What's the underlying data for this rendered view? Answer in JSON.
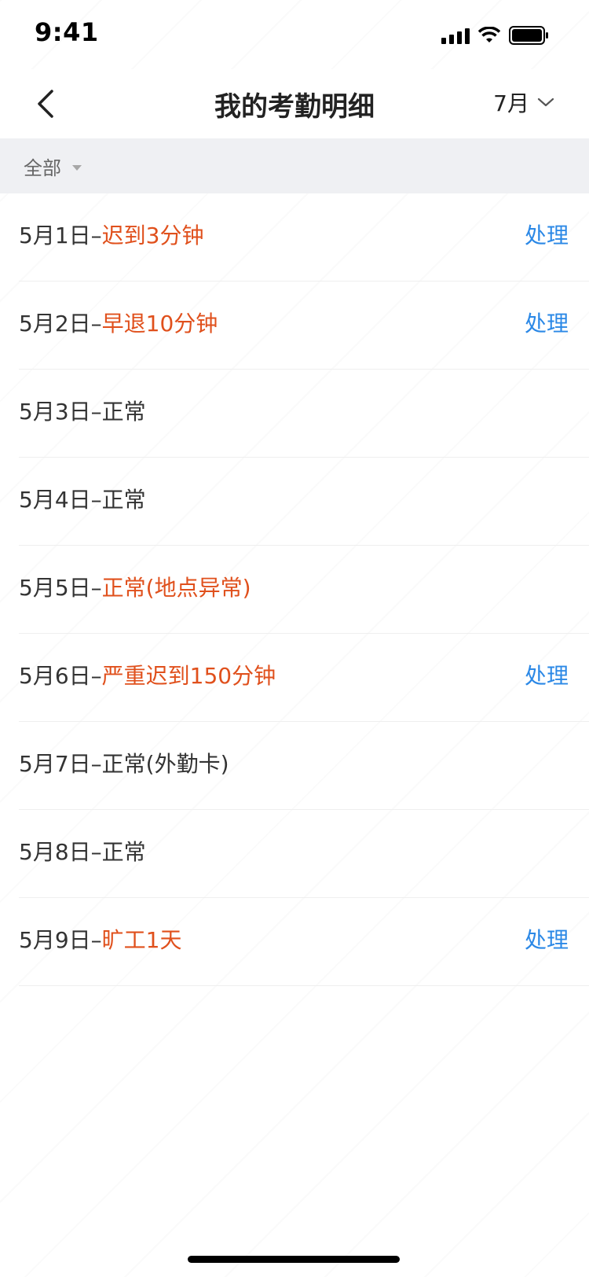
{
  "status_bar": {
    "time": "9:41"
  },
  "nav": {
    "title": "我的考勤明细",
    "month": "7月"
  },
  "filter": {
    "label": "全部"
  },
  "rows": [
    {
      "date": "5月1日–",
      "status": "迟到3分钟",
      "abnormal": true,
      "action": "处理"
    },
    {
      "date": "5月2日–",
      "status": "早退10分钟",
      "abnormal": true,
      "action": "处理"
    },
    {
      "date": "5月3日–",
      "status": "正常",
      "abnormal": false,
      "action": ""
    },
    {
      "date": "5月4日–",
      "status": "正常",
      "abnormal": false,
      "action": ""
    },
    {
      "date": "5月5日–",
      "status": "正常(地点异常)",
      "abnormal": true,
      "action": ""
    },
    {
      "date": "5月6日–",
      "status": "严重迟到150分钟",
      "abnormal": true,
      "action": "处理"
    },
    {
      "date": "5月7日–",
      "status": "正常(外勤卡)",
      "abnormal": false,
      "action": ""
    },
    {
      "date": "5月8日–",
      "status": "正常",
      "abnormal": false,
      "action": ""
    },
    {
      "date": "5月9日–",
      "status": "旷工1天",
      "abnormal": true,
      "action": "处理"
    }
  ],
  "colors": {
    "abnormal": "#e0501c",
    "action": "#2b88e6",
    "normal": "#333333",
    "filter_bg": "#eff0f3"
  },
  "icons": {
    "back": "chevron-left-icon",
    "month_dropdown": "chevron-down-icon",
    "filter_dropdown": "triangle-down-icon"
  }
}
